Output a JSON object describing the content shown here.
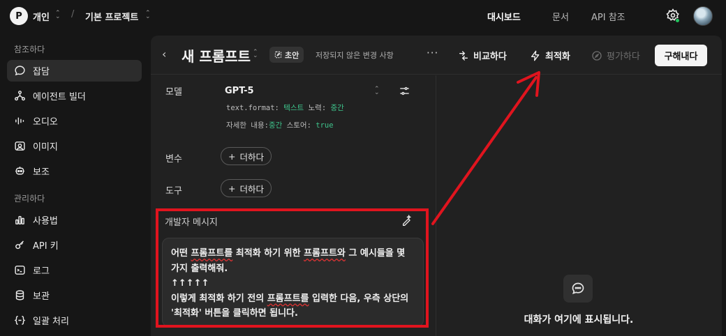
{
  "topbar": {
    "org_initial": "P",
    "org_name": "개인",
    "separator": "/",
    "project_name": "기본 프로젝트",
    "nav": [
      "대시보드",
      "문서",
      "API 참조"
    ],
    "active_nav": "대시보드",
    "status_dot_color": "#22c55e"
  },
  "sidebar": {
    "section_reference": "참조하다",
    "reference_items": [
      {
        "label": "잡담",
        "icon": "chat-bubble-icon",
        "active": true
      },
      {
        "label": "에이전트 빌더",
        "icon": "agent-builder-icon"
      },
      {
        "label": "오디오",
        "icon": "audio-wave-icon"
      },
      {
        "label": "이미지",
        "icon": "image-icon"
      },
      {
        "label": "보조",
        "icon": "assistant-bot-icon"
      }
    ],
    "section_manage": "관리하다",
    "manage_items": [
      {
        "label": "사용법",
        "icon": "usage-chart-icon"
      },
      {
        "label": "API 키",
        "icon": "key-icon"
      },
      {
        "label": "로그",
        "icon": "terminal-log-icon"
      },
      {
        "label": "보관",
        "icon": "storage-database-icon"
      },
      {
        "label": "일괄 처리",
        "icon": "batch-braces-icon"
      }
    ]
  },
  "prompt": {
    "title": "새 프롬프트",
    "draft_badge": "초안",
    "unsaved_text": "저장되지 않은 변경 사항",
    "more_label": "···",
    "compare_label": "비교하다",
    "optimize_label": "최적화",
    "evaluate_label": "평가하다",
    "buy_label": "구해내다",
    "model_label": "모델",
    "model_name": "GPT-5",
    "params": {
      "format_key": "text.format:",
      "format_val": "텍스트",
      "effort_key": "노력:",
      "effort_val": "중간",
      "verbosity_key": "자세한 내용:",
      "verbosity_val": "중간",
      "store_key": "스토어:",
      "store_val": "true"
    },
    "variables_label": "변수",
    "tools_label": "도구",
    "add_label": "더하다",
    "developer_message_label": "개발자 메시지",
    "developer_message": {
      "line1_pre": "어떤 ",
      "line1_word": "프롬프트를",
      "line1_mid": " 최적화 하기 위한 ",
      "line1_word2": "프롬프트와",
      "line1_post": " 그 예시들을 몇",
      "line2": "가지 출력해줘.",
      "line3": "↑↑↑↑↑",
      "line4_pre": "이렇게 최적화 하기 전의 ",
      "line4_word": "프롬프트를",
      "line4_post": " 입력한 다음, 우측 상단의",
      "line5": "'최적화' 버튼을 클릭하면 됩니다."
    },
    "empty_state": "대화가 여기에 표시됩니다."
  },
  "annotation": {
    "color": "#e0141e"
  }
}
